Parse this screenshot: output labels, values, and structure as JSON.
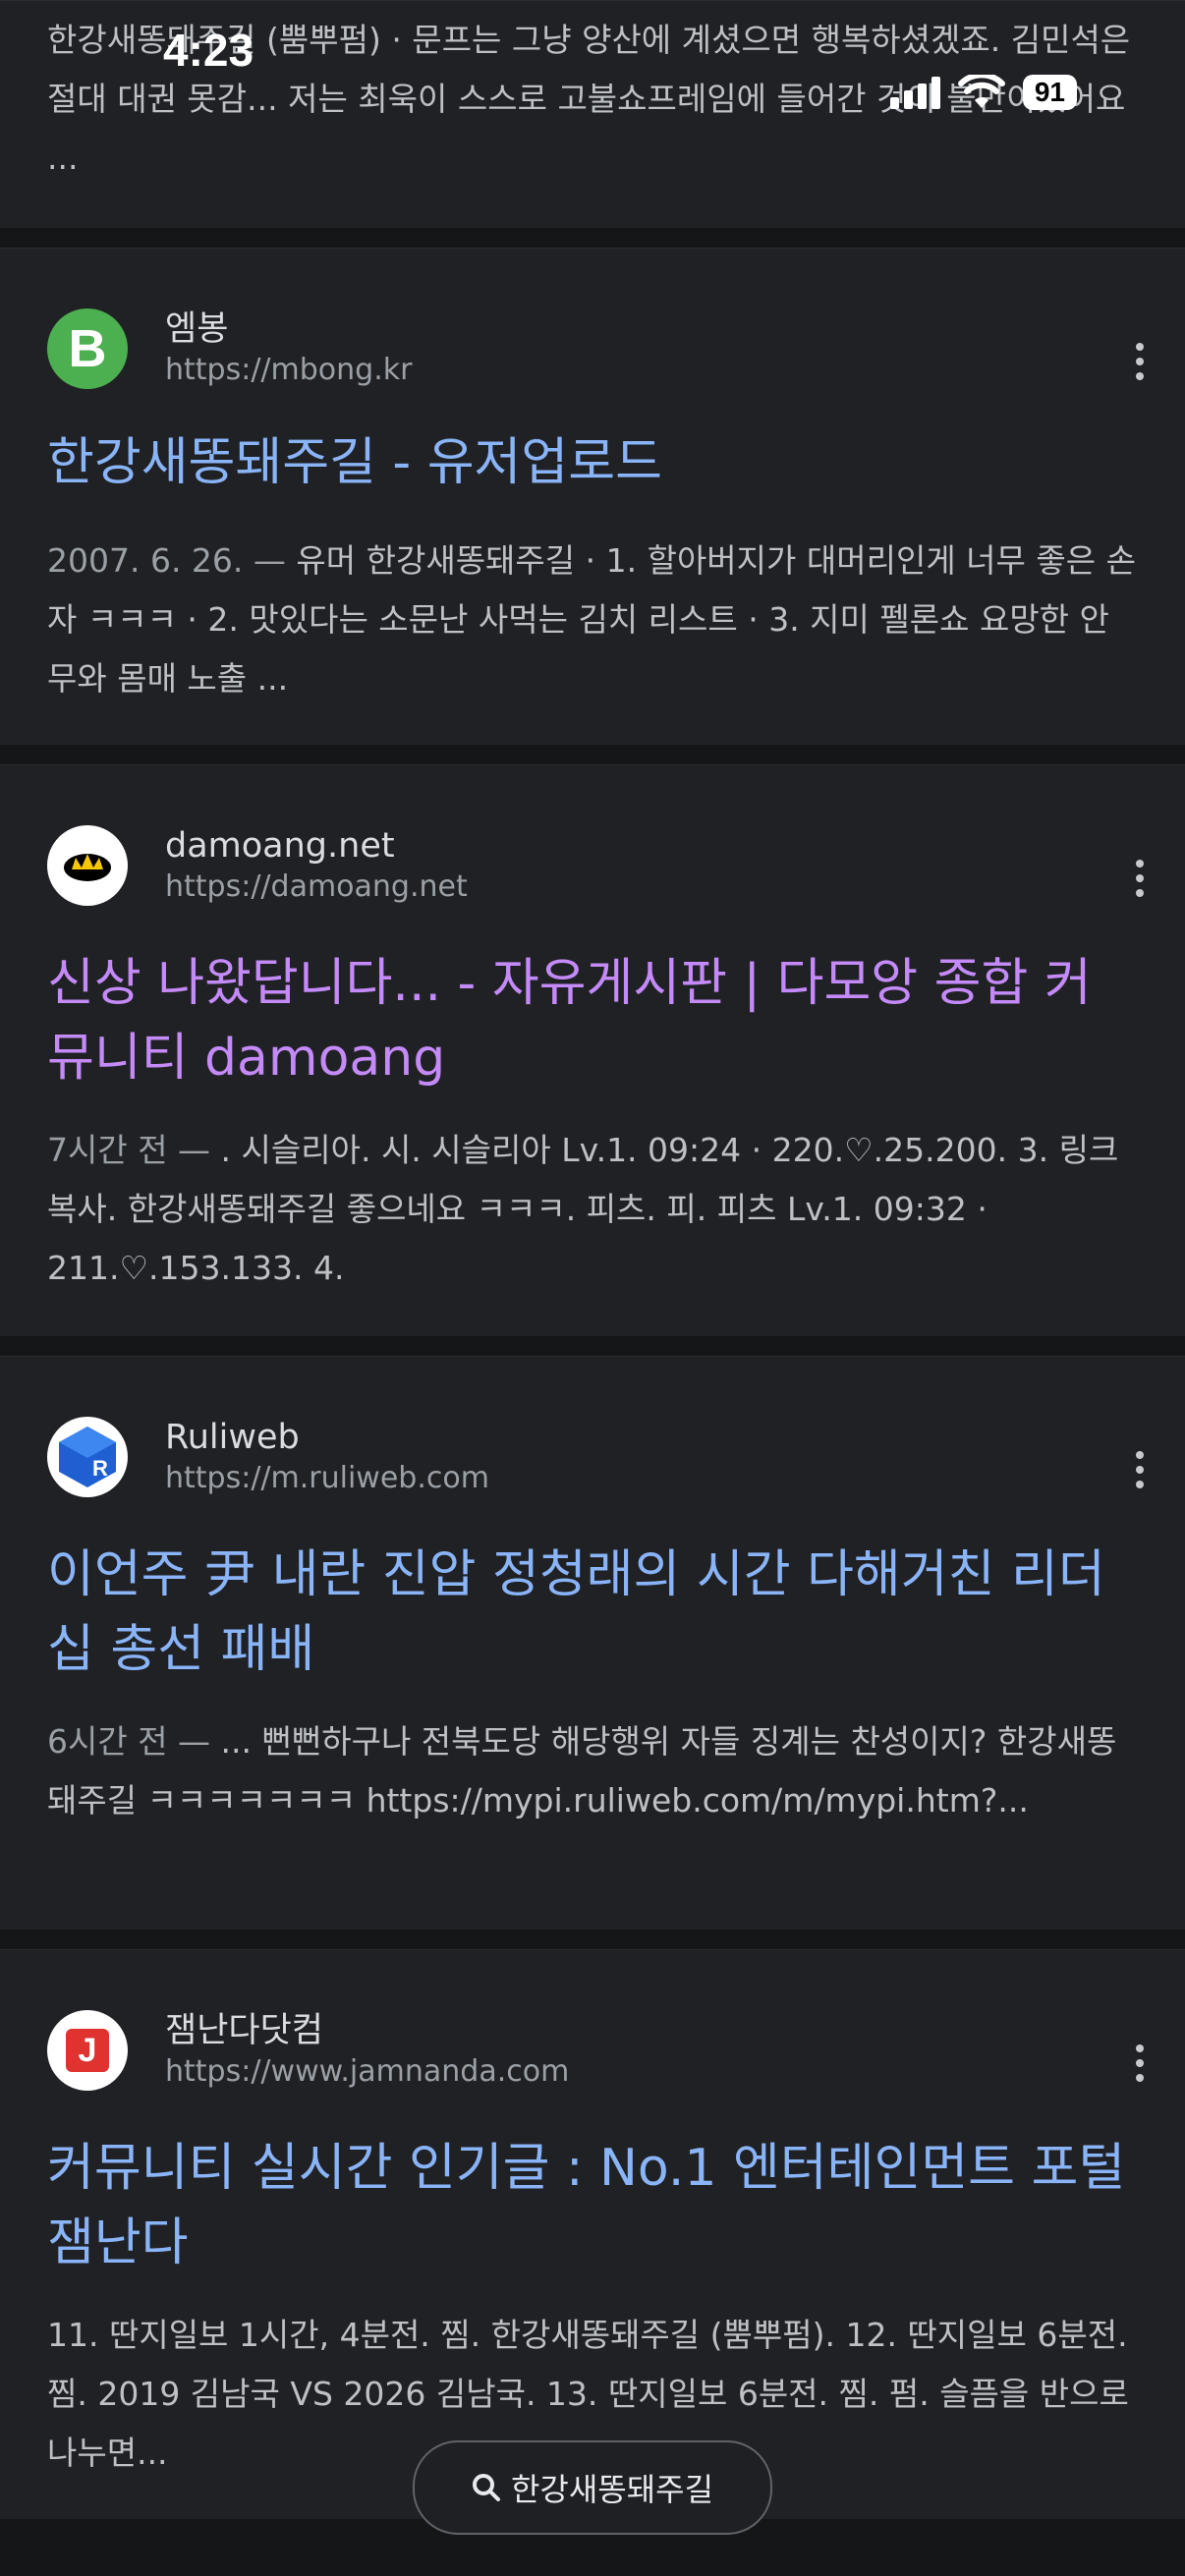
{
  "status_bar": {
    "time": "4:23",
    "battery": "91"
  },
  "top_snippet": "한강새똥돼주길 (뿜뿌펌) · 문프는 그냥 양산에 계셨으면 행복하셨겠죠. 김민석은 절대 대권 못감... 저는 최욱이 스스로 고불쇼프레임에 들어간 것이 불만이었어요 ...",
  "results": [
    {
      "site_name": "엠봉",
      "url": "https://mbong.kr",
      "favicon_letter": "B",
      "title": "한강새똥돼주길 - 유저업로드",
      "date": "2007. 6. 26. —",
      "snippet": " 유머 한강새똥돼주길 · 1. 할아버지가 대머리인게 너무 좋은 손자 ㅋㅋㅋ · 2. 맛있다는 소문난 사먹는 김치 리스트 · 3. 지미 펠론쇼 요망한 안무와 몸매 노출 ..."
    },
    {
      "site_name": "damoang.net",
      "url": "https://damoang.net",
      "favicon_letter": "",
      "title": "신상 나왔답니다... - 자유게시판 | 다모앙 종합 커뮤니티 damoang",
      "date": "7시간 전 —",
      "snippet": " . 시슬리아. 시. 시슬리아 Lv.1. 09:24 · 220.♡.25.200. 3. 링크복사. 한강새똥돼주길 좋으네요 ㅋㅋㅋ. 피츠. 피. 피츠 Lv.1. 09:32 · 211.♡.153.133. 4."
    },
    {
      "site_name": "Ruliweb",
      "url": "https://m.ruliweb.com",
      "favicon_letter": "R",
      "title": "이언주 尹 내란 진압 정청래의 시간 다해거친 리더십 총선 패배",
      "date": "6시간 전 —",
      "snippet": " ... 뻔뻔하구나 전북도당 해당행위 자들 징계는 찬성이지? 한강새똥돼주길 ㅋㅋㅋㅋㅋㅋㅋ https://mypi.ruliweb.com/m/mypi.htm?..."
    },
    {
      "site_name": "잼난다닷컴",
      "url": "https://www.jamnanda.com",
      "favicon_letter": "J",
      "title": "커뮤니티 실시간 인기글 : No.1 엔터테인먼트 포털 잼난다",
      "date": "",
      "snippet": "11. 딴지일보 1시간, 4분전. 찜. 한강새똥돼주길 (뿜뿌펌). 12. 딴지일보 6분전. 찜. 2019 김남국 VS 2026 김남국. 13. 딴지일보 6분전. 찜. 펌. 슬픔을 반으로 나누면..."
    }
  ],
  "search_pill": {
    "query": "한강새똥돼주길",
    "icon": "search-icon"
  },
  "colors": {
    "link": "#8ab4f8",
    "visited": "#c58af9",
    "background": "#202124"
  }
}
